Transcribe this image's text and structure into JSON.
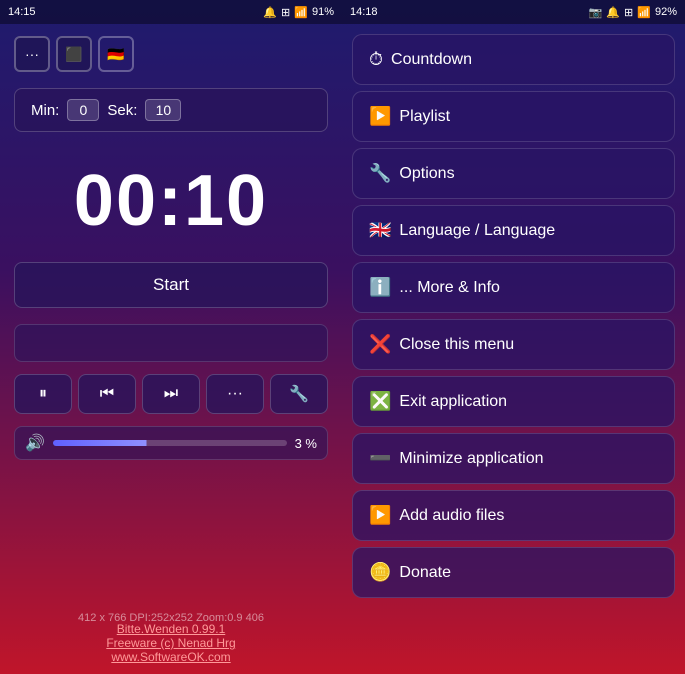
{
  "left": {
    "status": {
      "time": "14:15",
      "icons": "🔔 ⊞ 📶",
      "battery": "91%"
    },
    "top_buttons": [
      {
        "label": "···",
        "name": "more-button"
      },
      {
        "label": "⬛",
        "name": "screen-button"
      },
      {
        "label": "🇩🇪",
        "name": "flag-button"
      }
    ],
    "min_label": "Min:",
    "min_value": "0",
    "sek_label": "Sek:",
    "sek_value": "10",
    "timer": "00:10",
    "start_label": "Start",
    "controls": [
      {
        "icon": "⏸",
        "name": "pause"
      },
      {
        "icon": "⏮",
        "name": "prev"
      },
      {
        "icon": "⏭",
        "name": "next"
      },
      {
        "icon": "···",
        "name": "more"
      },
      {
        "icon": "🔧",
        "name": "settings"
      }
    ],
    "volume_pct": "3 %",
    "info_text": "412 x 766 DPI:252x252 Zoom:0.9 406",
    "footer_line1": "Bitte.Wenden 0.99.1",
    "footer_line2": "Freeware (c) Nenad Hrg",
    "footer_line3": "www.SoftwareOK.com"
  },
  "right": {
    "status": {
      "time": "14:18",
      "icons": "📷 🔔 ⊞ 📶",
      "battery": "92%"
    },
    "menu_items": [
      {
        "icon": "⏱",
        "label": "Countdown",
        "name": "menu-countdown"
      },
      {
        "icon": "▶️",
        "label": "Playlist",
        "name": "menu-playlist"
      },
      {
        "icon": "🔧",
        "label": "Options",
        "name": "menu-options"
      },
      {
        "icon": "🇬🇧",
        "label": "Language / Language",
        "name": "menu-language"
      },
      {
        "icon": "ℹ️",
        "label": "... More & Info",
        "name": "menu-more-info"
      },
      {
        "icon": "❌",
        "label": "Close this menu",
        "name": "menu-close"
      },
      {
        "icon": "❎",
        "label": "Exit application",
        "name": "menu-exit"
      },
      {
        "icon": "➖",
        "label": "Minimize application",
        "name": "menu-minimize"
      },
      {
        "icon": "▶️",
        "label": "Add audio files",
        "name": "menu-add-audio"
      },
      {
        "icon": "🪙",
        "label": "Donate",
        "name": "menu-donate"
      }
    ]
  }
}
